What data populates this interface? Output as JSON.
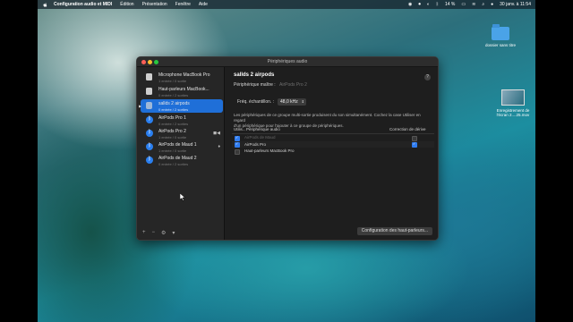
{
  "menubar": {
    "app_name": "Configuration audio et MIDI",
    "menus": [
      "Édition",
      "Présentation",
      "Fenêtre",
      "Aide"
    ],
    "battery": "14 %",
    "datetime": "30 janv. à 11:54"
  },
  "desktop": {
    "folder_label": "dossier sans titre",
    "screenshot_label_line1": "Enregistrement de",
    "screenshot_label_line2": "l'écran 2....25.mov"
  },
  "window": {
    "title": "Périphériques audio"
  },
  "sidebar": {
    "devices": [
      {
        "name": "Microphone MacBook Pro",
        "sub": "1 entrée / 0 sortie",
        "icon": "microphone-icon",
        "selected": false
      },
      {
        "name": "Haut-parleurs MacBook...",
        "sub": "0 entrée / 2 sorties",
        "icon": "speaker-icon",
        "selected": false
      },
      {
        "name": "sallds 2 airpods",
        "sub": "0 entrée / 2 sorties",
        "icon": "aggregate-device-icon",
        "selected": true
      },
      {
        "name": "AirPods Pro 1",
        "sub": "0 entrée / 2 sorties",
        "icon": "bluetooth-icon",
        "selected": false
      },
      {
        "name": "AirPods Pro 2",
        "sub": "1 entrée / 0 sortie",
        "icon": "bluetooth-icon",
        "selected": false
      },
      {
        "name": "AirPods de Maud 1",
        "sub": "1 entrée / 0 sortie",
        "icon": "bluetooth-icon",
        "selected": false
      },
      {
        "name": "AirPods de Maud 2",
        "sub": "0 entrée / 2 sorties",
        "icon": "bluetooth-icon",
        "selected": false
      }
    ],
    "tools": [
      "+",
      "−",
      "⚙",
      "▾"
    ]
  },
  "main": {
    "device_title": "sallds 2 airpods",
    "master_label": "Périphérique maître :",
    "master_value": "AirPods Pro 2",
    "rate_label": "Fréq. échantillon. :",
    "rate_value": "48,0 kHz",
    "description_line1": "Les périphériques de ce groupe multi-sortie produisent du son simultanément. Cochez la case Utiliser en regard",
    "description_line2": "d'un périphérique pour l'ajouter à ce groupe de périphériques.",
    "table_headers": {
      "use": "Utilis...",
      "device": "Périphérique audio",
      "drift": "Correction de dérive"
    },
    "rows": [
      {
        "device": "AirPods de Maud",
        "use": true,
        "drift": false,
        "dim": true
      },
      {
        "device": "AirPods Pro",
        "use": true,
        "drift": true,
        "dim": false
      },
      {
        "device": "Haut-parleurs MacBook Pro",
        "use": false,
        "drift": false,
        "dim": false
      }
    ],
    "speaker_button": "Configuration des haut-parleurs..."
  }
}
